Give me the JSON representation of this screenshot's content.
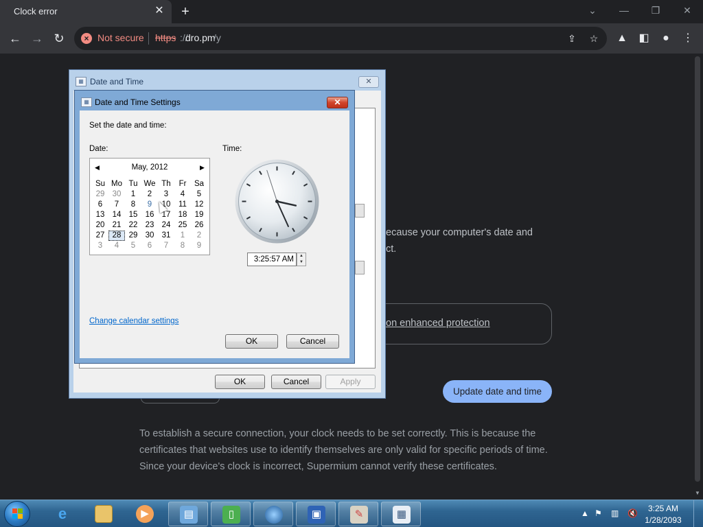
{
  "browser": {
    "tab_title": "Clock error",
    "url_scheme": "https",
    "url_separator": "://",
    "url_host": "dro.pm",
    "url_path": "/y",
    "security_label": "Not secure"
  },
  "page": {
    "partial_text_1": "ecause your computer's date and",
    "partial_text_2": "ct.",
    "enhanced_link": "on enhanced protection",
    "update_button": "Update date and time",
    "bottom_paragraph": "To establish a secure connection, your clock needs to be set correctly. This is because the certificates that websites use to identify themselves are only valid for specific periods of time. Since your device's clock is incorrect, Supermium cannot verify these certificates."
  },
  "outer_dialog": {
    "title": "Date and Time",
    "ok": "OK",
    "cancel": "Cancel",
    "apply": "Apply"
  },
  "inner_dialog": {
    "title": "Date and Time Settings",
    "prompt": "Set the date and time:",
    "date_label": "Date:",
    "time_label": "Time:",
    "calendar": {
      "month": "May, 2012",
      "weekdays": [
        "Su",
        "Mo",
        "Tu",
        "We",
        "Th",
        "Fr",
        "Sa"
      ],
      "weeks": [
        [
          "29",
          "30",
          "1",
          "2",
          "3",
          "4",
          "5"
        ],
        [
          "6",
          "7",
          "8",
          "9",
          "10",
          "11",
          "12"
        ],
        [
          "13",
          "14",
          "15",
          "16",
          "17",
          "18",
          "19"
        ],
        [
          "20",
          "21",
          "22",
          "23",
          "24",
          "25",
          "26"
        ],
        [
          "27",
          "28",
          "29",
          "30",
          "31",
          "1",
          "2"
        ],
        [
          "3",
          "4",
          "5",
          "6",
          "7",
          "8",
          "9"
        ]
      ],
      "selected_day": "28"
    },
    "time_value": "3:25:57 AM",
    "change_calendar_link": "Change calendar settings",
    "ok": "OK",
    "cancel": "Cancel"
  },
  "taskbar": {
    "clock_time": "3:25 AM",
    "clock_date": "1/28/2093"
  },
  "colors": {
    "chrome_bg": "#202124",
    "toolbar_bg": "#35363a",
    "not_secure": "#f28b82",
    "accent_button": "#8ab4f8",
    "link_blue": "#0066cc"
  }
}
